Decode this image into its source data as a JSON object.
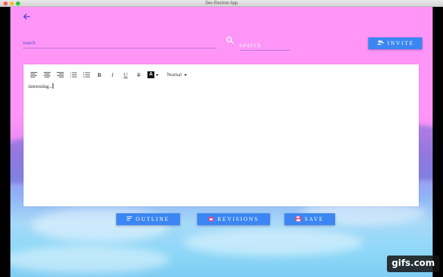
{
  "window": {
    "title": "Dev Electron App"
  },
  "header": {
    "back_icon": "arrow-left-icon",
    "search_left_value": "search",
    "search_icon": "search-icon",
    "search_right_placeholder": "search",
    "invite_label": "INVITE",
    "invite_icon": "add-group-icon"
  },
  "editor": {
    "toolbar": {
      "tools": [
        "align-left-icon",
        "align-center-icon",
        "align-right-icon",
        "ordered-list-icon",
        "bullet-list-icon",
        "bold-icon",
        "italic-icon",
        "underline-icon",
        "strikethrough-icon",
        "text-color-icon"
      ],
      "bold_label": "B",
      "italic_label": "I",
      "underline_label": "U",
      "strike_label": "T",
      "color_label": "A",
      "size_value": "Normal"
    },
    "content": "interesting..."
  },
  "actions": {
    "outline_label": "OUTLINE",
    "outline_icon": "subject-icon",
    "revisions_label": "REVISIONS",
    "revisions_icon": "calendar-icon",
    "save_label": "SAVE",
    "save_icon": "floppy-disk-icon"
  },
  "watermark": {
    "text": "gifs.com"
  },
  "colors": {
    "accent": "#3b86f2",
    "background_top": "#ff96f7",
    "background_bottom": "#7fcdf4",
    "link": "#4b3fc4"
  }
}
